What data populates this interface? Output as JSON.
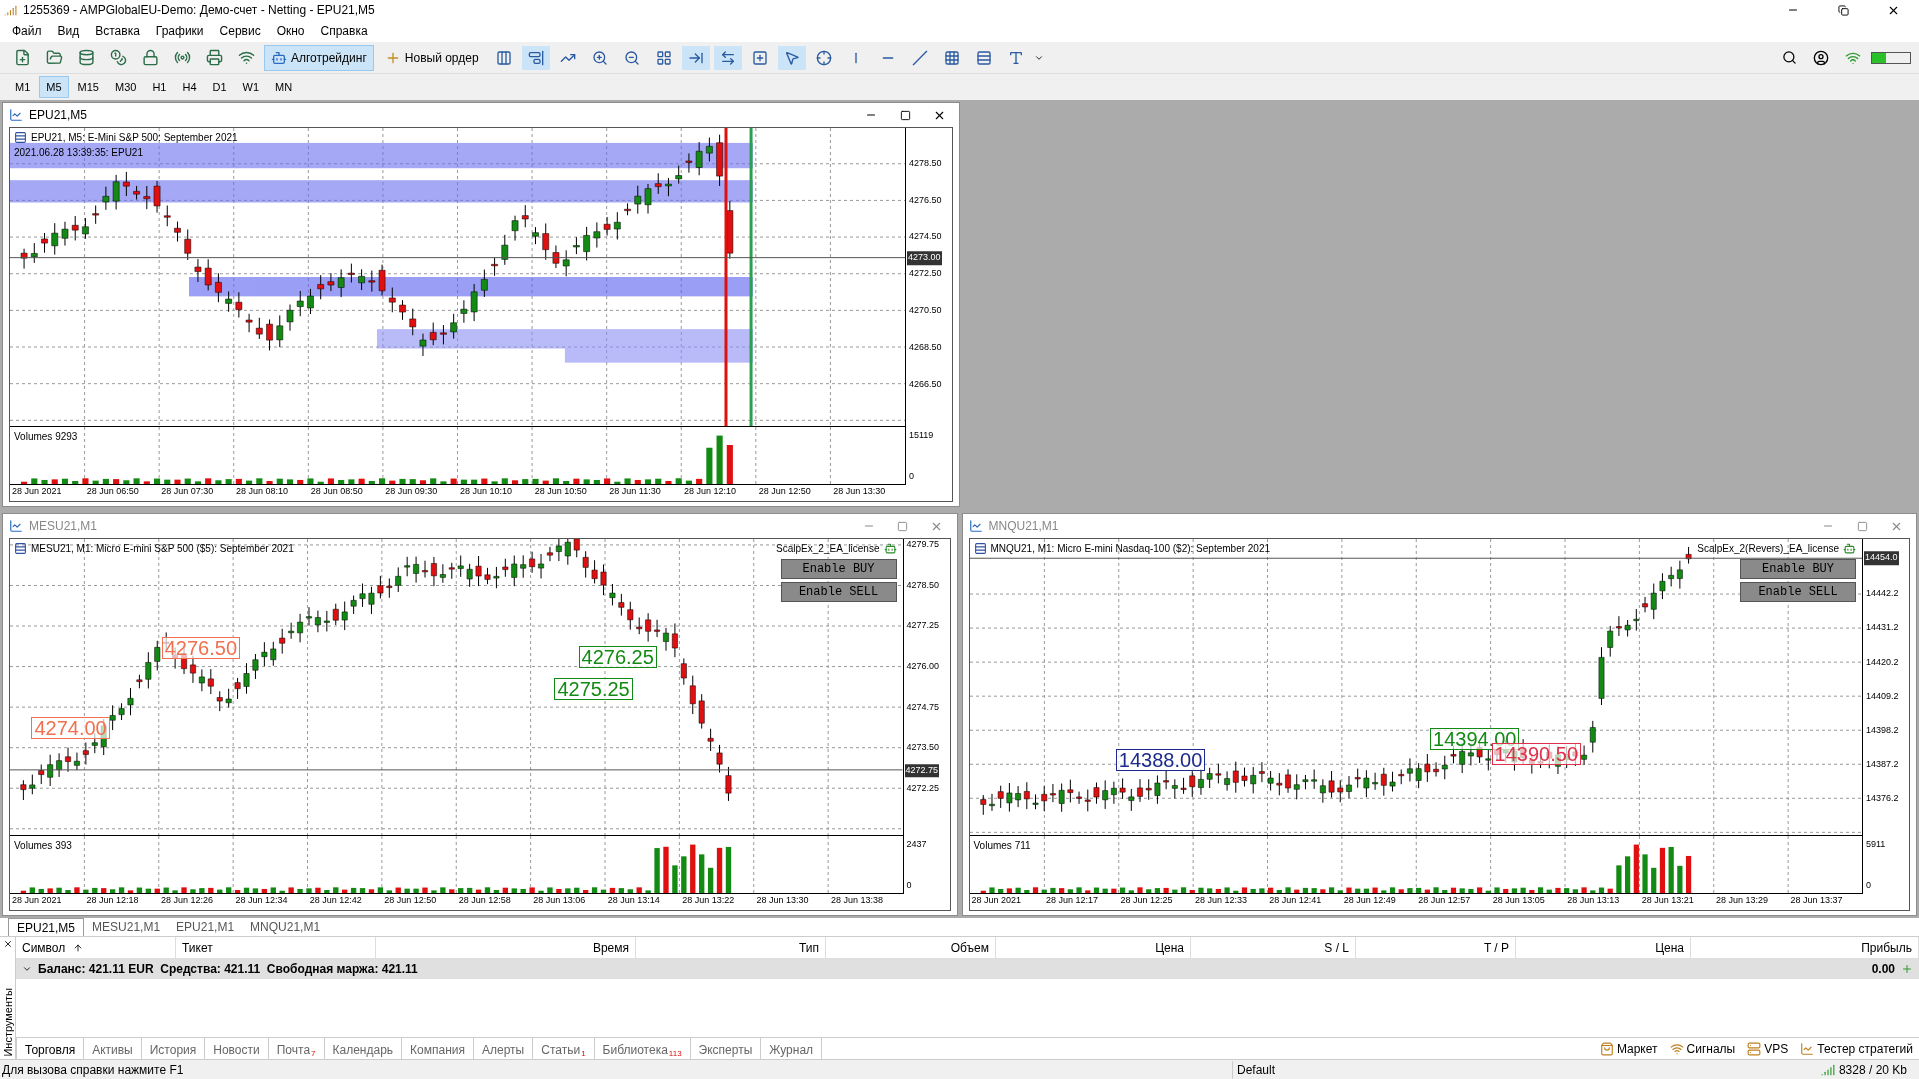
{
  "window": {
    "title": "1255369 - AMPGlobalEU-Demo: Демо-счет - Netting - EPU21,M5"
  },
  "menu": [
    "Файл",
    "Вид",
    "Вставка",
    "Графики",
    "Сервис",
    "Окно",
    "Справка"
  ],
  "toolbar": {
    "buttons": [
      {
        "label": "Алготрейдинг",
        "selected": true
      },
      {
        "label": "Новый ордер",
        "selected": false
      }
    ]
  },
  "timeframes": [
    {
      "label": "M1",
      "selected": false
    },
    {
      "label": "M5",
      "selected": true
    },
    {
      "label": "M15",
      "selected": false
    },
    {
      "label": "M30",
      "selected": false
    },
    {
      "label": "H1",
      "selected": false
    },
    {
      "label": "H4",
      "selected": false
    },
    {
      "label": "D1",
      "selected": false
    },
    {
      "label": "W1",
      "selected": false
    },
    {
      "label": "MN",
      "selected": false
    }
  ],
  "charts": [
    {
      "title": "EPU21,M5",
      "active": true,
      "info": "EPU21, M5: E-Mini S&P 500: September 2021",
      "info2": "2021.06.28 13:39:35: EPU21",
      "price_ticks": [
        "4278.50",
        "4276.50",
        "4274.50",
        "4272.50",
        "4270.50",
        "4268.50",
        "4266.50"
      ],
      "current_price": "4273.00",
      "volumes_label": "Volumes 9293",
      "volume_ticks": [
        "15119",
        "0"
      ],
      "time_ticks": [
        "28 Jun 2021",
        "28 Jun 06:50",
        "28 Jun 07:30",
        "28 Jun 08:10",
        "28 Jun 08:50",
        "28 Jun 09:30",
        "28 Jun 10:10",
        "28 Jun 10:50",
        "28 Jun 11:30",
        "28 Jun 12:10",
        "28 Jun 12:50",
        "28 Jun 13:30"
      ]
    },
    {
      "title": "MESU21,M1",
      "active": false,
      "info": "MESU21, M1: Micro E-mini S&P 500 ($5): September 2021",
      "price_ticks": [
        "4279.75",
        "4278.50",
        "4277.25",
        "4276.00",
        "4274.75",
        "4273.50",
        "4272.25"
      ],
      "current_price": "4272.75",
      "volumes_label": "Volumes 393",
      "volume_ticks": [
        "2437",
        "0"
      ],
      "time_ticks": [
        "28 Jun 2021",
        "28 Jun 12:18",
        "28 Jun 12:26",
        "28 Jun 12:34",
        "28 Jun 12:42",
        "28 Jun 12:50",
        "28 Jun 12:58",
        "28 Jun 13:06",
        "28 Jun 13:14",
        "28 Jun 13:22",
        "28 Jun 13:30",
        "28 Jun 13:38"
      ],
      "ea": {
        "label": "ScalpEx_2_EA_license",
        "buttons": [
          "Enable BUY",
          "Enable SELL"
        ]
      },
      "price_tags": [
        {
          "text": "4276.50",
          "color": "#f07050"
        },
        {
          "text": "4274.00",
          "color": "#f07050"
        },
        {
          "text": "4276.25",
          "color": "#138a13"
        },
        {
          "text": "4275.25",
          "color": "#138a13"
        }
      ]
    },
    {
      "title": "MNQU21,M1",
      "active": false,
      "info": "MNQU21, M1: Micro E-mini Nasdaq-100 ($2): September 2021",
      "price_ticks": [
        "14442.2",
        "14431.2",
        "14420.2",
        "14409.2",
        "14398.2",
        "14387.2",
        "14376.2"
      ],
      "current_price": "14454.0",
      "volumes_label": "Volumes 711",
      "volume_ticks": [
        "5911",
        "0"
      ],
      "time_ticks": [
        "28 Jun 2021",
        "28 Jun 12:17",
        "28 Jun 12:25",
        "28 Jun 12:33",
        "28 Jun 12:41",
        "28 Jun 12:49",
        "28 Jun 12:57",
        "28 Jun 13:05",
        "28 Jun 13:13",
        "28 Jun 13:21",
        "28 Jun 13:29",
        "28 Jun 13:37"
      ],
      "ea": {
        "label": "ScalpEx_2(Revers)_EA_license",
        "buttons": [
          "Enable BUY",
          "Enable SELL"
        ]
      },
      "price_tags": [
        {
          "text": "14388.00",
          "color": "#1c2a8c"
        },
        {
          "text": "14394.00",
          "color": "#138a13"
        },
        {
          "text": "14390.50",
          "color": "#e0304a"
        }
      ]
    }
  ],
  "chart_tabs": [
    {
      "label": "EPU21,M5",
      "selected": true
    },
    {
      "label": "MESU21,M1",
      "selected": false
    },
    {
      "label": "EPU21,M1",
      "selected": false
    },
    {
      "label": "MNQU21,M1",
      "selected": false
    }
  ],
  "toolbox": {
    "side_label": "Инструменты",
    "columns": [
      "Символ",
      "Тикет",
      "Время",
      "Тип",
      "Объем",
      "Цена",
      "S / L",
      "T / P",
      "Цена",
      "Прибыль"
    ],
    "balance_row": {
      "text": "Баланс: 421.11 EUR  Средства: 421.11  Свободная маржа: 421.11",
      "profit": "0.00"
    },
    "tabs": [
      {
        "label": "Торговля",
        "selected": true
      },
      {
        "label": "Активы",
        "selected": false
      },
      {
        "label": "История",
        "selected": false
      },
      {
        "label": "Новости",
        "selected": false
      },
      {
        "label": "Почта",
        "badge": "7",
        "selected": false
      },
      {
        "label": "Календарь",
        "selected": false
      },
      {
        "label": "Компания",
        "selected": false
      },
      {
        "label": "Алерты",
        "selected": false
      },
      {
        "label": "Статьи",
        "badge": "1",
        "selected": false
      },
      {
        "label": "Библиотека",
        "badge": "113",
        "selected": false
      },
      {
        "label": "Эксперты",
        "selected": false
      },
      {
        "label": "Журнал",
        "selected": false
      }
    ],
    "links": [
      "Маркет",
      "Сигналы",
      "VPS",
      "Тестер стратегий"
    ]
  },
  "status_bar": {
    "help": "Для вызова справки нажмите F1",
    "profile": "Default",
    "traffic": "8328 / 20 Kb"
  }
}
